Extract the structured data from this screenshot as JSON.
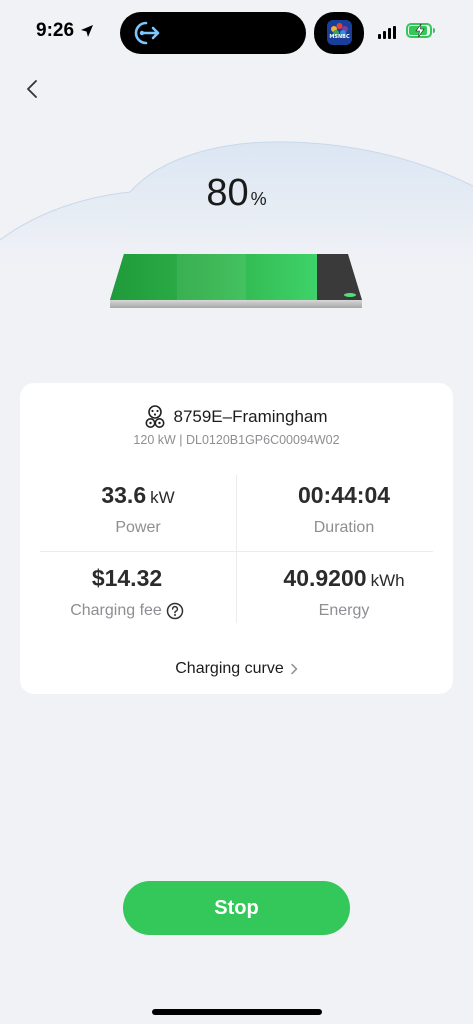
{
  "status_bar": {
    "time": "9:26",
    "app_badge_label": "MSNBC",
    "battery_level": 0.8,
    "colors": {
      "battery": "#34c759"
    }
  },
  "header": {
    "percent_value": "80",
    "percent_unit": "%",
    "battery_level": 0.8
  },
  "station": {
    "name": "8759E–Framingham",
    "details": "120 kW | DL0120B1GP6C00094W02"
  },
  "metrics": {
    "power": {
      "value": "33.6",
      "unit": "kW",
      "label": "Power"
    },
    "duration": {
      "value": "00:44:04",
      "label": "Duration"
    },
    "fee": {
      "value": "$14.32",
      "label": "Charging fee"
    },
    "energy": {
      "value": "40.9200",
      "unit": "kWh",
      "label": "Energy"
    }
  },
  "charging_curve": {
    "label": "Charging curve"
  },
  "actions": {
    "stop_label": "Stop"
  },
  "colors": {
    "accent": "#34c759",
    "background": "#f1f2f6",
    "card": "#ffffff",
    "muted_text": "#8e8e93"
  }
}
